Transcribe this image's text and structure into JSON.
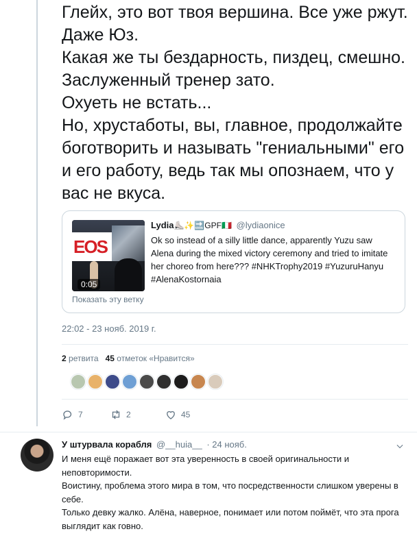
{
  "tweet": {
    "text_lines": [
      "Глейх, это вот твоя вершина. Все уже ржут. Даже Юз.",
      "Какая же ты бездарность, пиздец, смешно. Заслуженный тренер зато.",
      "Охуеть не встать...",
      "Но, хрустаботы, вы, главное, продолжайте боготворить и называть \"гениальными\" его и его работу, ведь так мы опознаем, что у вас не вкуса."
    ],
    "timestamp": "22:02 - 23 нояб. 2019 г.",
    "stats": {
      "retweets_count": "2",
      "retweets_label": "ретвита",
      "likes_count": "45",
      "likes_label": "отметок «Нравится»"
    },
    "actions": {
      "reply_count": "7",
      "retweet_count": "2",
      "like_count": "45"
    },
    "liker_colors": [
      "#b8c7b0",
      "#e8b26a",
      "#3d4b8a",
      "#6e9fd4",
      "#4a4a4a",
      "#2f2f2f",
      "#1c1c1c",
      "#c7864f",
      "#d9cbbb"
    ]
  },
  "quoted_tweet": {
    "name": "Lydia",
    "emoji": "⛸️✨🔜GPF🇮🇹",
    "handle": "@lydiaonice",
    "body": "Ok so instead of a silly little dance, apparently Yuzu saw Alena during the mixed victory ceremony and tried to imitate her choreo from here??? #NHKTrophy2019 #YuzuruHanyu #AlenaKostornaia",
    "video_duration": "0:05",
    "thumb_logo": "EOS",
    "show_thread": "Показать эту ветку"
  },
  "reply": {
    "name": "У штурвала корабля",
    "handle": "@__huia__",
    "date": "· 24 нояб.",
    "paragraphs": [
      "И меня ещё поражает вот эта уверенность в своей оригинальности и неповторимости.",
      "Воистину, проблема этого мира в том, что посредственности слишком уверены в себе.",
      "Только девку жалко. Алёна, наверное, понимает или потом поймёт, что эта прога выглядит как говно."
    ]
  }
}
